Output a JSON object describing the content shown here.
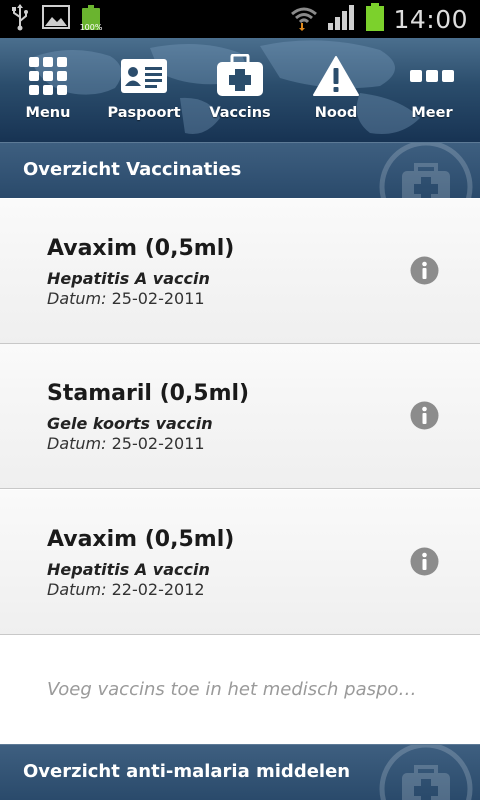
{
  "status_bar": {
    "battery_small_label": "100%",
    "time": "14:00",
    "icons": [
      "usb-icon",
      "image-icon",
      "battery-icon",
      "wifi-icon",
      "signal-icon",
      "battery-icon"
    ]
  },
  "nav": {
    "items": [
      {
        "label": "Menu",
        "icon": "grid-icon"
      },
      {
        "label": "Paspoort",
        "icon": "id-card-icon"
      },
      {
        "label": "Vaccins",
        "icon": "medical-kit-icon"
      },
      {
        "label": "Nood",
        "icon": "warning-icon"
      },
      {
        "label": "Meer",
        "icon": "more-icon"
      }
    ]
  },
  "vaccinations": {
    "header": "Overzicht Vaccinaties",
    "items": [
      {
        "name": "Avaxim (0,5ml)",
        "type": "Hepatitis A vaccin",
        "date_label": "Datum:",
        "date": "25-02-2011"
      },
      {
        "name": "Stamaril (0,5ml)",
        "type": "Gele koorts vaccin",
        "date_label": "Datum:",
        "date": "25-02-2011"
      },
      {
        "name": "Avaxim (0,5ml)",
        "type": "Hepatitis A vaccin",
        "date_label": "Datum:",
        "date": "22-02-2012"
      }
    ],
    "hint": "Voeg vaccins toe in het medisch paspo…"
  },
  "malaria": {
    "header": "Overzicht anti-malaria middelen"
  },
  "colors": {
    "header_bg": "#2a4a6b",
    "battery_green": "#6ab42f",
    "info_icon": "#8c8c8c"
  }
}
